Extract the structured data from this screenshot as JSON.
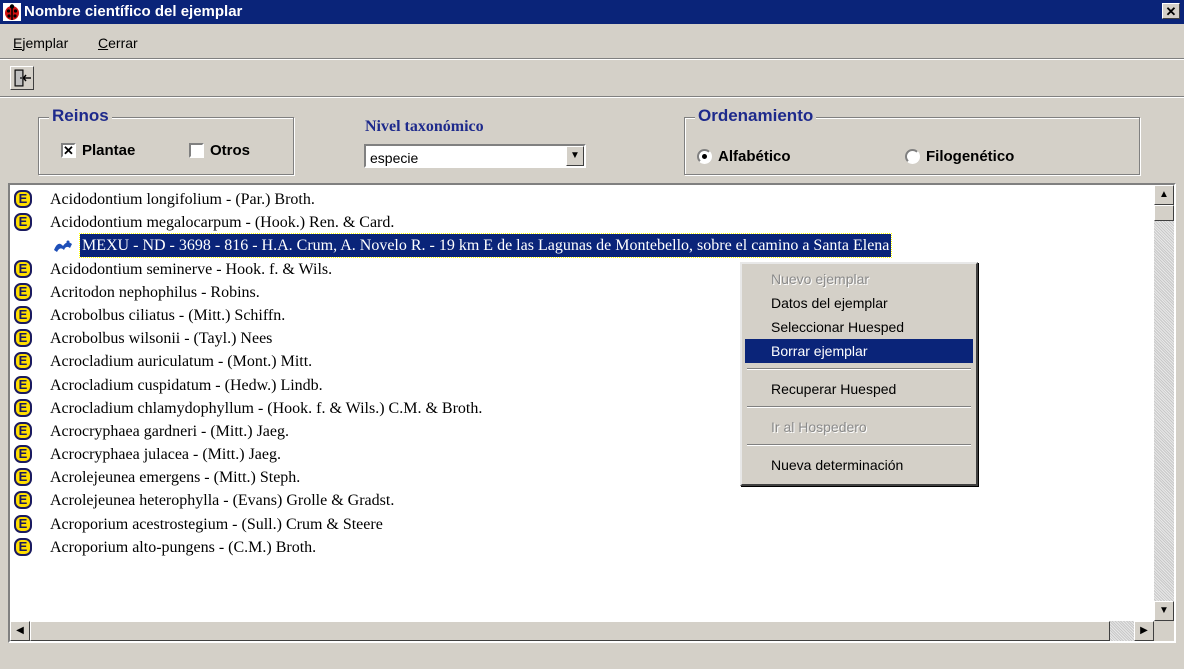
{
  "window": {
    "title": "Nombre científico del ejemplar",
    "close_label": "✕"
  },
  "menu": [
    {
      "label": "Ejemplar",
      "accel": "E"
    },
    {
      "label": "Cerrar",
      "accel": "C"
    }
  ],
  "toolbar": {
    "exit_icon": "door-exit-icon"
  },
  "reinos": {
    "legend": "Reinos",
    "plantae": {
      "label": "Plantae",
      "checked": true
    },
    "otros": {
      "label": "Otros",
      "checked": false
    }
  },
  "nivel": {
    "label": "Nivel taxonómico",
    "value": "especie"
  },
  "ordenamiento": {
    "legend": "Ordenamiento",
    "alfabetico": {
      "label": "Alfabético",
      "selected": true
    },
    "filogenetico": {
      "label": "Filogenético",
      "selected": false
    }
  },
  "list": {
    "rows": [
      {
        "type": "species",
        "badge": "E",
        "text": "Acidodontium longifolium - (Par.) Broth."
      },
      {
        "type": "species",
        "badge": "E",
        "text": "Acidodontium megalocarpum - (Hook.) Ren. & Card."
      },
      {
        "type": "specimen",
        "text": "MEXU - ND - 3698 -  816 - H.A. Crum, A. Novelo R. - 19 km E de las Lagunas de Montebello, sobre el camino a Santa Elena"
      },
      {
        "type": "species",
        "badge": "E",
        "text": "Acidodontium seminerve - Hook. f. & Wils."
      },
      {
        "type": "species",
        "badge": "E",
        "text": "Acritodon nephophilus - Robins."
      },
      {
        "type": "species",
        "badge": "E",
        "text": "Acrobolbus ciliatus - (Mitt.) Schiffn."
      },
      {
        "type": "species",
        "badge": "E",
        "text": "Acrobolbus wilsonii - (Tayl.) Nees"
      },
      {
        "type": "species",
        "badge": "E",
        "text": "Acrocladium auriculatum  - (Mont.) Mitt."
      },
      {
        "type": "species",
        "badge": "E",
        "text": "Acrocladium cuspidatum - (Hedw.) Lindb."
      },
      {
        "type": "species",
        "badge": "E",
        "text": "Acrocladium chlamydophyllum - (Hook. f. & Wils.) C.M. & Broth."
      },
      {
        "type": "species",
        "badge": "E",
        "text": "Acrocryphaea gardneri - (Mitt.) Jaeg."
      },
      {
        "type": "species",
        "badge": "E",
        "text": "Acrocryphaea julacea - (Mitt.) Jaeg."
      },
      {
        "type": "species",
        "badge": "E",
        "text": "Acrolejeunea emergens - (Mitt.) Steph."
      },
      {
        "type": "species",
        "badge": "E",
        "text": "Acrolejeunea heterophylla - (Evans) Grolle & Gradst."
      },
      {
        "type": "species",
        "badge": "E",
        "text": "Acroporium acestrostegium - (Sull.) Crum & Steere"
      },
      {
        "type": "species",
        "badge": "E",
        "text": "Acroporium alto-pungens - (C.M.) Broth."
      }
    ]
  },
  "context_menu": {
    "items": [
      {
        "label": "Nuevo ejemplar",
        "disabled": true
      },
      {
        "label": "Datos del ejemplar",
        "disabled": false
      },
      {
        "label": "Seleccionar Huesped",
        "disabled": false
      },
      {
        "label": "Borrar ejemplar",
        "disabled": false,
        "active": true
      },
      {
        "label": "Recuperar Huesped",
        "disabled": false
      },
      {
        "label": "Ir al Hospedero",
        "disabled": true
      },
      {
        "label": "Nueva determinación",
        "disabled": false
      }
    ]
  },
  "colors": {
    "titlebar": "#0a2479",
    "accent_text": "#1e2a8c",
    "badge": "#ffde00",
    "selection": "#0a2479"
  }
}
